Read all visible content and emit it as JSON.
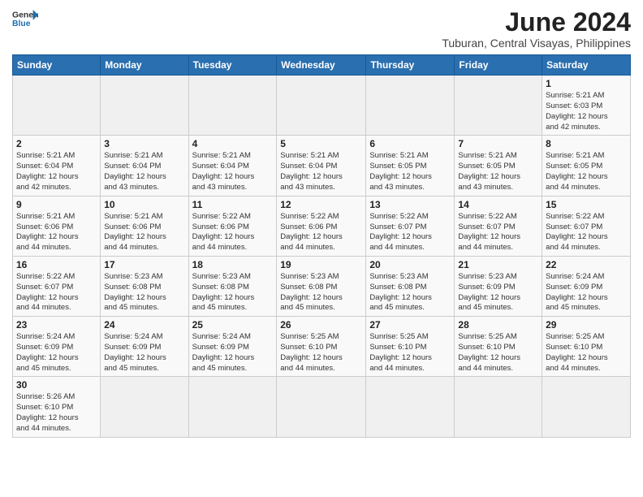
{
  "header": {
    "logo_general": "General",
    "logo_blue": "Blue",
    "title": "June 2024",
    "location": "Tuburan, Central Visayas, Philippines"
  },
  "days_of_week": [
    "Sunday",
    "Monday",
    "Tuesday",
    "Wednesday",
    "Thursday",
    "Friday",
    "Saturday"
  ],
  "weeks": [
    [
      {
        "day": "",
        "info": ""
      },
      {
        "day": "",
        "info": ""
      },
      {
        "day": "",
        "info": ""
      },
      {
        "day": "",
        "info": ""
      },
      {
        "day": "",
        "info": ""
      },
      {
        "day": "",
        "info": ""
      },
      {
        "day": "1",
        "info": "Sunrise: 5:21 AM\nSunset: 6:03 PM\nDaylight: 12 hours\nand 42 minutes."
      }
    ],
    [
      {
        "day": "2",
        "info": "Sunrise: 5:21 AM\nSunset: 6:04 PM\nDaylight: 12 hours\nand 42 minutes."
      },
      {
        "day": "3",
        "info": "Sunrise: 5:21 AM\nSunset: 6:04 PM\nDaylight: 12 hours\nand 43 minutes."
      },
      {
        "day": "4",
        "info": "Sunrise: 5:21 AM\nSunset: 6:04 PM\nDaylight: 12 hours\nand 43 minutes."
      },
      {
        "day": "5",
        "info": "Sunrise: 5:21 AM\nSunset: 6:04 PM\nDaylight: 12 hours\nand 43 minutes."
      },
      {
        "day": "6",
        "info": "Sunrise: 5:21 AM\nSunset: 6:05 PM\nDaylight: 12 hours\nand 43 minutes."
      },
      {
        "day": "7",
        "info": "Sunrise: 5:21 AM\nSunset: 6:05 PM\nDaylight: 12 hours\nand 43 minutes."
      },
      {
        "day": "8",
        "info": "Sunrise: 5:21 AM\nSunset: 6:05 PM\nDaylight: 12 hours\nand 44 minutes."
      }
    ],
    [
      {
        "day": "9",
        "info": "Sunrise: 5:21 AM\nSunset: 6:06 PM\nDaylight: 12 hours\nand 44 minutes."
      },
      {
        "day": "10",
        "info": "Sunrise: 5:21 AM\nSunset: 6:06 PM\nDaylight: 12 hours\nand 44 minutes."
      },
      {
        "day": "11",
        "info": "Sunrise: 5:22 AM\nSunset: 6:06 PM\nDaylight: 12 hours\nand 44 minutes."
      },
      {
        "day": "12",
        "info": "Sunrise: 5:22 AM\nSunset: 6:06 PM\nDaylight: 12 hours\nand 44 minutes."
      },
      {
        "day": "13",
        "info": "Sunrise: 5:22 AM\nSunset: 6:07 PM\nDaylight: 12 hours\nand 44 minutes."
      },
      {
        "day": "14",
        "info": "Sunrise: 5:22 AM\nSunset: 6:07 PM\nDaylight: 12 hours\nand 44 minutes."
      },
      {
        "day": "15",
        "info": "Sunrise: 5:22 AM\nSunset: 6:07 PM\nDaylight: 12 hours\nand 44 minutes."
      }
    ],
    [
      {
        "day": "16",
        "info": "Sunrise: 5:22 AM\nSunset: 6:07 PM\nDaylight: 12 hours\nand 44 minutes."
      },
      {
        "day": "17",
        "info": "Sunrise: 5:23 AM\nSunset: 6:08 PM\nDaylight: 12 hours\nand 45 minutes."
      },
      {
        "day": "18",
        "info": "Sunrise: 5:23 AM\nSunset: 6:08 PM\nDaylight: 12 hours\nand 45 minutes."
      },
      {
        "day": "19",
        "info": "Sunrise: 5:23 AM\nSunset: 6:08 PM\nDaylight: 12 hours\nand 45 minutes."
      },
      {
        "day": "20",
        "info": "Sunrise: 5:23 AM\nSunset: 6:08 PM\nDaylight: 12 hours\nand 45 minutes."
      },
      {
        "day": "21",
        "info": "Sunrise: 5:23 AM\nSunset: 6:09 PM\nDaylight: 12 hours\nand 45 minutes."
      },
      {
        "day": "22",
        "info": "Sunrise: 5:24 AM\nSunset: 6:09 PM\nDaylight: 12 hours\nand 45 minutes."
      }
    ],
    [
      {
        "day": "23",
        "info": "Sunrise: 5:24 AM\nSunset: 6:09 PM\nDaylight: 12 hours\nand 45 minutes."
      },
      {
        "day": "24",
        "info": "Sunrise: 5:24 AM\nSunset: 6:09 PM\nDaylight: 12 hours\nand 45 minutes."
      },
      {
        "day": "25",
        "info": "Sunrise: 5:24 AM\nSunset: 6:09 PM\nDaylight: 12 hours\nand 45 minutes."
      },
      {
        "day": "26",
        "info": "Sunrise: 5:25 AM\nSunset: 6:10 PM\nDaylight: 12 hours\nand 44 minutes."
      },
      {
        "day": "27",
        "info": "Sunrise: 5:25 AM\nSunset: 6:10 PM\nDaylight: 12 hours\nand 44 minutes."
      },
      {
        "day": "28",
        "info": "Sunrise: 5:25 AM\nSunset: 6:10 PM\nDaylight: 12 hours\nand 44 minutes."
      },
      {
        "day": "29",
        "info": "Sunrise: 5:25 AM\nSunset: 6:10 PM\nDaylight: 12 hours\nand 44 minutes."
      }
    ],
    [
      {
        "day": "30",
        "info": "Sunrise: 5:26 AM\nSunset: 6:10 PM\nDaylight: 12 hours\nand 44 minutes."
      },
      {
        "day": "",
        "info": ""
      },
      {
        "day": "",
        "info": ""
      },
      {
        "day": "",
        "info": ""
      },
      {
        "day": "",
        "info": ""
      },
      {
        "day": "",
        "info": ""
      },
      {
        "day": "",
        "info": ""
      }
    ]
  ]
}
